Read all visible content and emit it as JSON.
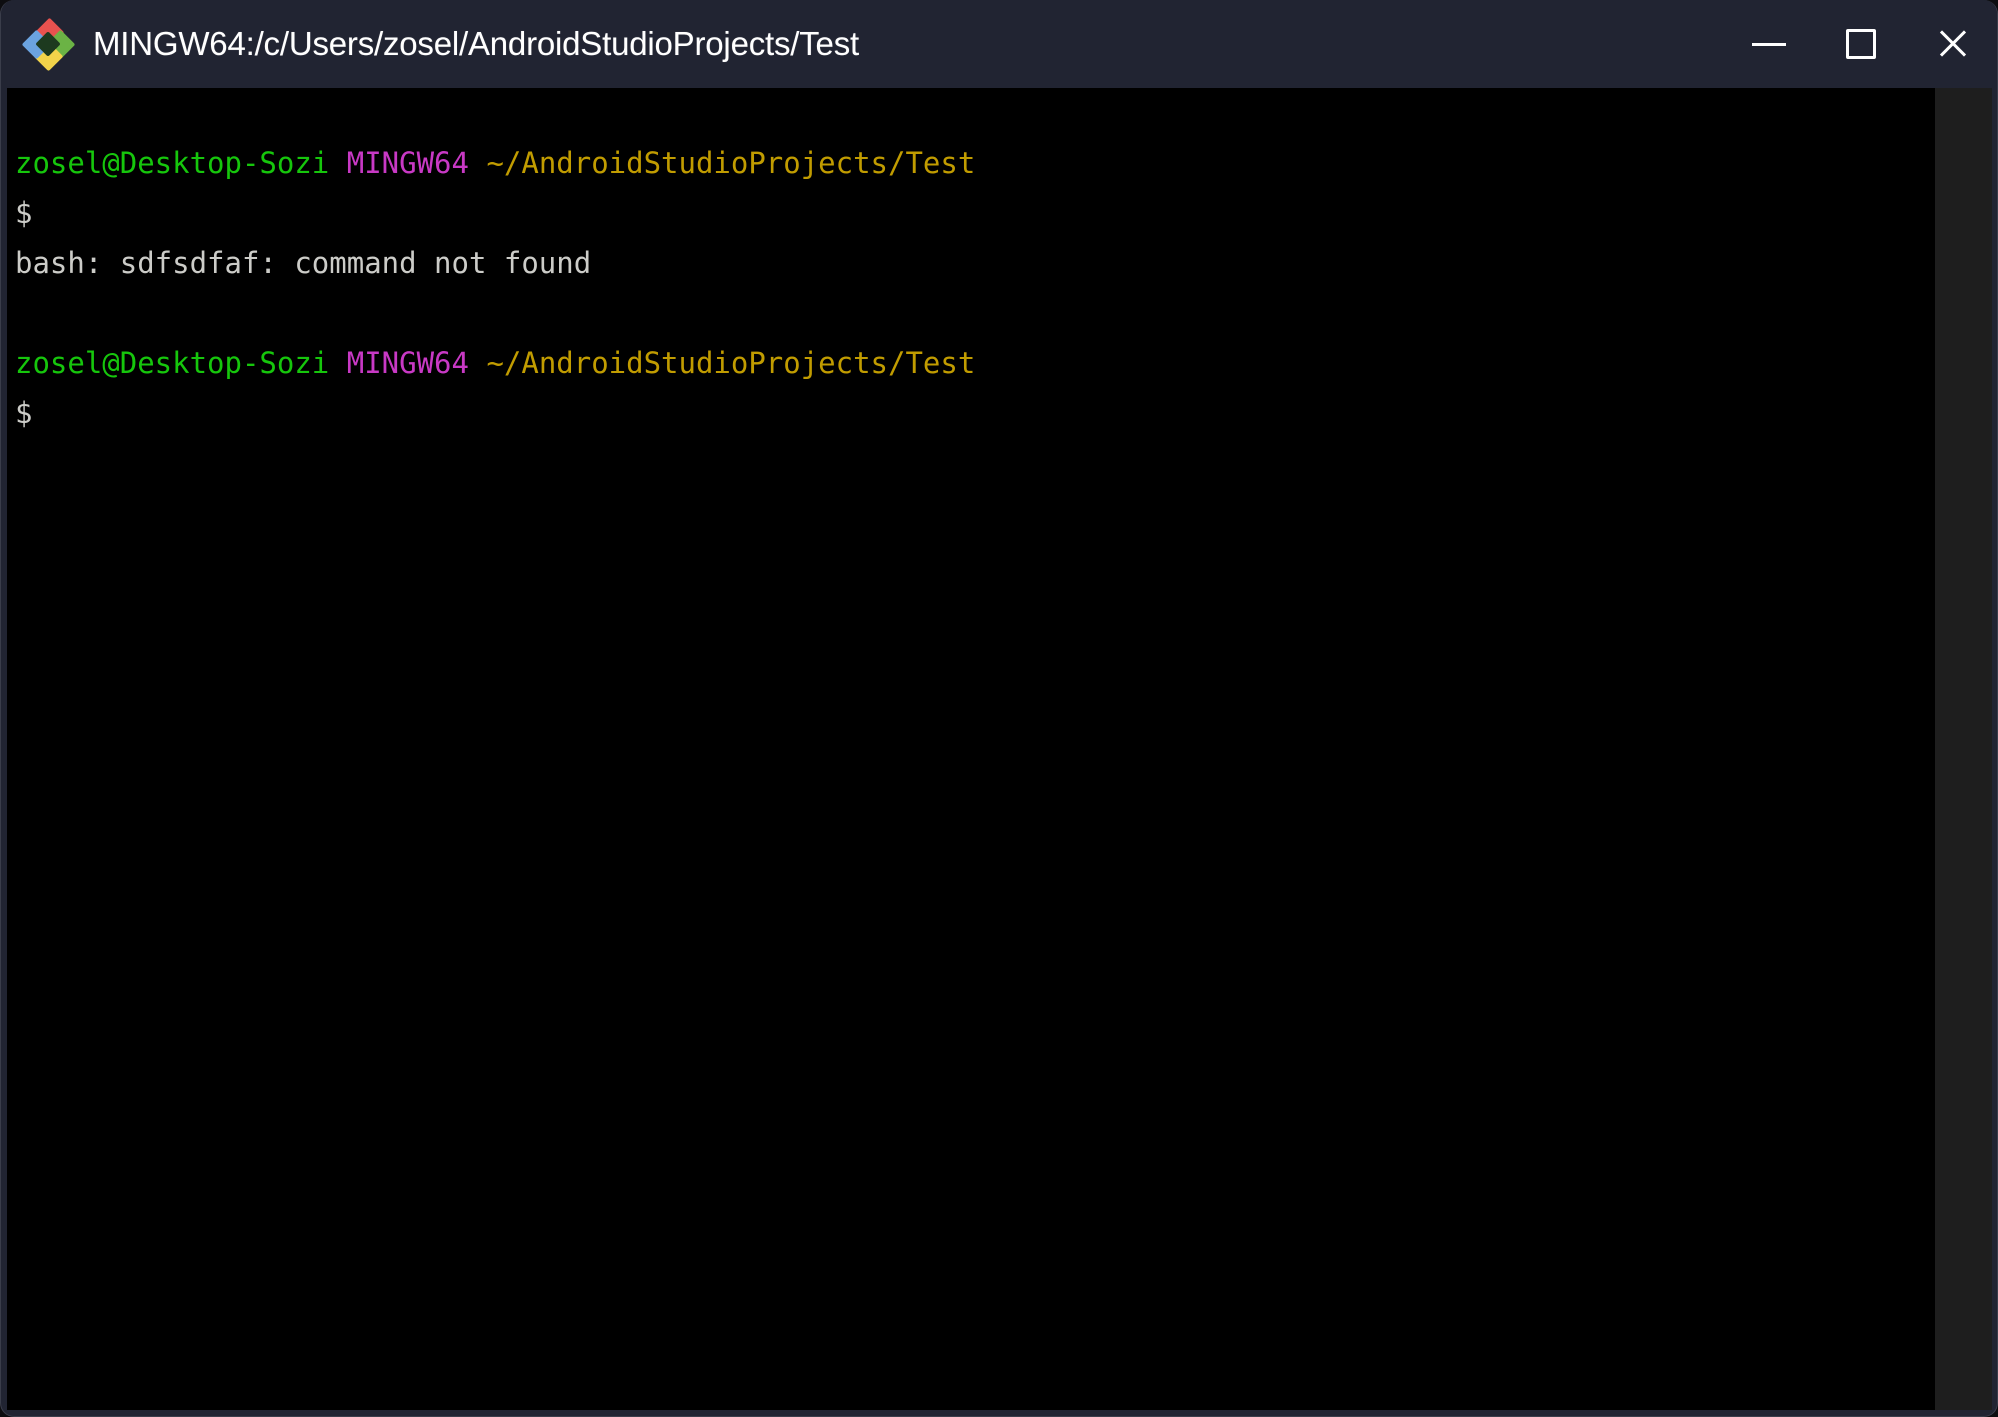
{
  "window": {
    "title": "MINGW64:/c/Users/zosel/AndroidStudioProjects/Test",
    "icon": "msys2-diamond-icon",
    "titlebar_bg": "#212432",
    "body_bg": "#000000",
    "border_color": "#3a3d4a"
  },
  "controls": {
    "minimize_label": "—",
    "maximize_label": "□",
    "close_label": "✕",
    "minimize_name": "minimize-button",
    "maximize_name": "maximize-button",
    "close_name": "close-button"
  },
  "terminal": {
    "prompt_user_host": "zosel@Desktop-Sozi",
    "prompt_shell": "MINGW64",
    "prompt_path": "~/AndroidStudioProjects/Test",
    "prompt_symbol": "$",
    "space": " ",
    "error_line": "bash: sdfsdfaf: command not found",
    "colors": {
      "user_host": "#16c60c",
      "shell": "#c839c5",
      "path": "#c19c00",
      "plain": "#ccccc8",
      "background": "#000000"
    },
    "lines": [
      {
        "type": "prompt"
      },
      {
        "type": "prompt_symbol"
      },
      {
        "type": "output",
        "text": "bash: sdfsdfaf: command not found"
      },
      {
        "type": "blank"
      },
      {
        "type": "prompt"
      },
      {
        "type": "prompt_symbol"
      }
    ]
  },
  "scrollbar": {
    "track_color": "#1c1c1c",
    "thumb_color": "#1e1e1e"
  }
}
